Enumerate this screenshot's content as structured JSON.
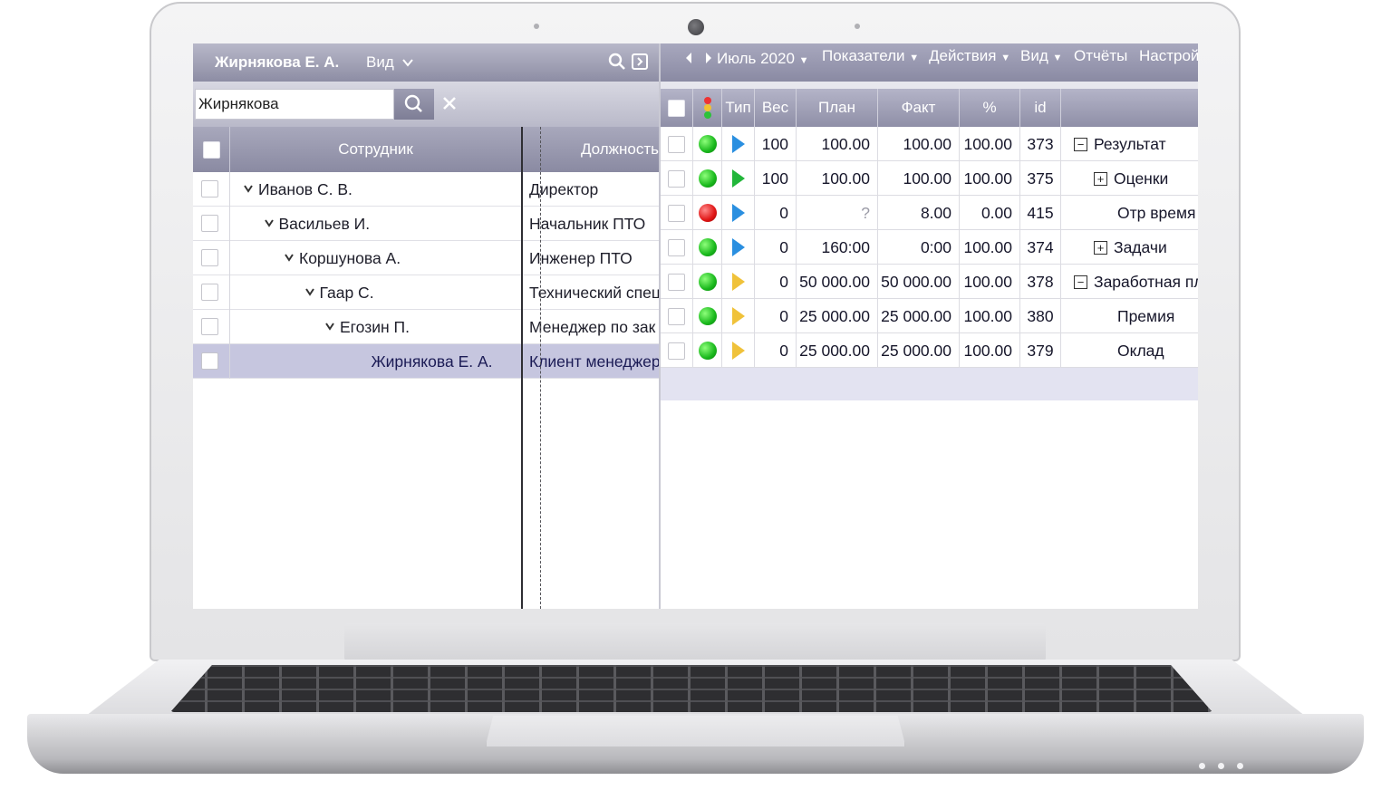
{
  "left": {
    "user_name": "Жирнякова Е. А.",
    "view_menu": "Вид",
    "search_value": "Жирнякова",
    "columns": {
      "employee": "Сотрудник",
      "position": "Должность"
    },
    "rows": [
      {
        "name": "Иванов С. В.",
        "position": "Директор",
        "level": 0
      },
      {
        "name": "Васильев И.",
        "position": "Начальник ПТО",
        "level": 1
      },
      {
        "name": "Коршунова А.",
        "position": "Инженер ПТО",
        "level": 2
      },
      {
        "name": "Гаар С.",
        "position": "Технический спец",
        "level": 3
      },
      {
        "name": "Егозин П.",
        "position": "Менеджер по зак",
        "level": 4
      },
      {
        "name": "Жирнякова Е. А.",
        "position": "Клиент менеджер",
        "level": 5,
        "selected": true
      }
    ]
  },
  "right": {
    "period": "Июль 2020",
    "menus": [
      "Показатели",
      "Действия",
      "Вид",
      "Отчёты",
      "Настрой"
    ],
    "columns": {
      "type": "Тип",
      "weight": "Вес",
      "plan": "План",
      "fact": "Факт",
      "percent": "%",
      "id": "id"
    },
    "rows": [
      {
        "status": "green",
        "type": "blue",
        "weight": "100",
        "plan": "100.00",
        "fact": "100.00",
        "percent": "100.00",
        "id": "373",
        "tree": "minus",
        "name": "Результат"
      },
      {
        "status": "green",
        "type": "green",
        "weight": "100",
        "plan": "100.00",
        "fact": "100.00",
        "percent": "100.00",
        "id": "375",
        "tree": "plus",
        "name": "Оценки"
      },
      {
        "status": "red",
        "type": "blue",
        "weight": "0",
        "plan": "?",
        "fact": "8.00",
        "percent": "0.00",
        "id": "415",
        "tree": "",
        "name": "Отр время"
      },
      {
        "status": "green",
        "type": "blue",
        "weight": "0",
        "plan": "160:00",
        "fact": "0:00",
        "percent": "100.00",
        "id": "374",
        "tree": "plus",
        "name": "Задачи"
      },
      {
        "status": "green",
        "type": "yellow",
        "weight": "0",
        "plan": "50 000.00",
        "fact": "50 000.00",
        "percent": "100.00",
        "id": "378",
        "tree": "minus",
        "name": "Заработная пл"
      },
      {
        "status": "green",
        "type": "yellow",
        "weight": "0",
        "plan": "25 000.00",
        "fact": "25 000.00",
        "percent": "100.00",
        "id": "380",
        "tree": "",
        "name": "Премия"
      },
      {
        "status": "green",
        "type": "yellow",
        "weight": "0",
        "plan": "25 000.00",
        "fact": "25 000.00",
        "percent": "100.00",
        "id": "379",
        "tree": "",
        "name": "Оклад"
      }
    ]
  },
  "icons": [
    "search-icon",
    "expand-icon",
    "clear-icon",
    "prev-icon",
    "next-icon",
    "traffic-light-icon",
    "status-lamp-icon",
    "type-flag-icon",
    "collapse-icon"
  ],
  "colors": {
    "toolbar": "#9a9ab0",
    "selected_row": "#c6c6df",
    "lamp_green": "#19b81c",
    "lamp_red": "#e01515",
    "flag_blue": "#2a8fe0",
    "flag_green": "#22b63a",
    "flag_yellow": "#f0c23a"
  }
}
